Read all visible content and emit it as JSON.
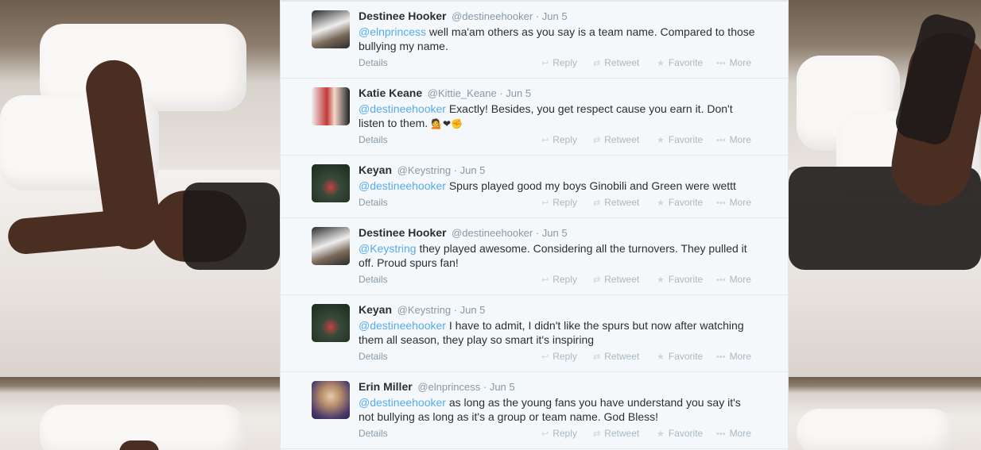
{
  "tweets": [
    {
      "fullname": "Destinee Hooker",
      "screenname": "@destineehooker",
      "time": "· Jun 5",
      "mention": "@elnprincess",
      "text": " well ma'am others as you say is a team name. Compared to those bullying my name.",
      "emoji": ""
    },
    {
      "fullname": "Katie Keane",
      "screenname": "@Kittie_Keane",
      "time": "· Jun 5",
      "mention": "@destineehooker",
      "text": " Exactly! Besides, you get respect cause you earn it. Don't listen to them. ",
      "emoji": "💁❤✊"
    },
    {
      "fullname": "Keyan",
      "screenname": "@Keystring",
      "time": "· Jun 5",
      "mention": "@destineehooker",
      "text": " Spurs played good my boys Ginobili and Green were wettt",
      "emoji": ""
    },
    {
      "fullname": "Destinee Hooker",
      "screenname": "@destineehooker",
      "time": "· Jun 5",
      "mention": "@Keystring",
      "text": " they played awesome. Considering all the turnovers. They pulled it off. Proud spurs fan!",
      "emoji": ""
    },
    {
      "fullname": "Keyan",
      "screenname": "@Keystring",
      "time": "· Jun 5",
      "mention": "@destineehooker",
      "text": " I have to admit, I didn't like the spurs but now after watching them all season, they play so smart it's inspiring",
      "emoji": ""
    },
    {
      "fullname": "Erin Miller",
      "screenname": "@elnprincess",
      "time": "· Jun 5",
      "mention": "@destineehooker",
      "text": " as long as the young fans you have understand you say it's not bullying as long as it's a group or team name. God Bless!",
      "emoji": ""
    }
  ],
  "actions": {
    "details": "Details",
    "reply": "Reply",
    "retweet": "Retweet",
    "favorite": "Favorite",
    "more": "More"
  },
  "icons": {
    "reply": "reply-icon",
    "retweet": "retweet-icon",
    "favorite": "star-icon",
    "more": "ellipsis-icon"
  },
  "colors": {
    "link": "#55acee",
    "text": "#292f33",
    "muted": "#8899a6",
    "action": "#aab8c2",
    "timeline_bg": "#f5f8fa"
  }
}
